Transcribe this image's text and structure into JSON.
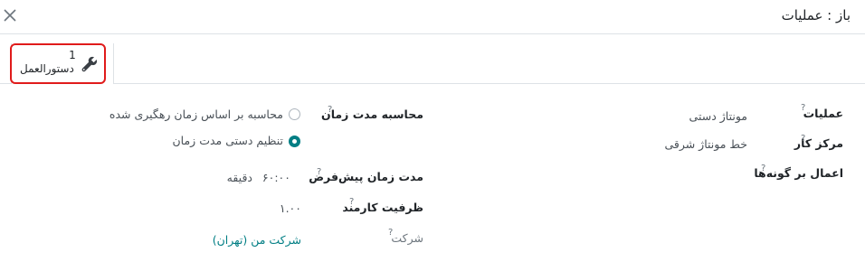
{
  "dialog": {
    "title": "باز : عملیات"
  },
  "tabs": [
    {
      "count": "1",
      "label": "دستورالعمل"
    }
  ],
  "fields": {
    "operation": {
      "label": "عملیات",
      "value": "مونتاژ دستی"
    },
    "work_center": {
      "label": "مرکز کار",
      "value": "خط مونتاژ شرقی"
    },
    "apply_on_variants": {
      "label": "اعمال بر گونه‌ها"
    },
    "duration_computation": {
      "label": "محاسبه مدت زمان",
      "options": [
        "محاسبه بر اساس زمان رهگیری شده",
        "تنظیم دستی مدت زمان"
      ],
      "selected_index": 1
    },
    "default_duration": {
      "label": "مدت زمان پیش‌فرض",
      "value": "۶۰:۰۰",
      "unit": "دقیقه"
    },
    "employee_capacity": {
      "label": "ظرفیت کارمند",
      "value": "۱.۰۰"
    },
    "company": {
      "label": "شرکت",
      "value": "شرکت من (تهران)"
    }
  },
  "help_marker": "?"
}
